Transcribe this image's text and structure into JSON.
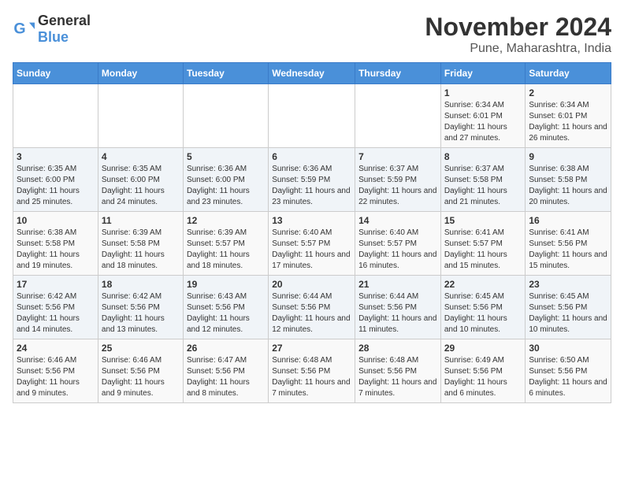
{
  "header": {
    "logo_general": "General",
    "logo_blue": "Blue",
    "month_title": "November 2024",
    "location": "Pune, Maharashtra, India"
  },
  "weekdays": [
    "Sunday",
    "Monday",
    "Tuesday",
    "Wednesday",
    "Thursday",
    "Friday",
    "Saturday"
  ],
  "rows": [
    [
      {
        "day": "",
        "info": ""
      },
      {
        "day": "",
        "info": ""
      },
      {
        "day": "",
        "info": ""
      },
      {
        "day": "",
        "info": ""
      },
      {
        "day": "",
        "info": ""
      },
      {
        "day": "1",
        "info": "Sunrise: 6:34 AM\nSunset: 6:01 PM\nDaylight: 11 hours and 27 minutes."
      },
      {
        "day": "2",
        "info": "Sunrise: 6:34 AM\nSunset: 6:01 PM\nDaylight: 11 hours and 26 minutes."
      }
    ],
    [
      {
        "day": "3",
        "info": "Sunrise: 6:35 AM\nSunset: 6:00 PM\nDaylight: 11 hours and 25 minutes."
      },
      {
        "day": "4",
        "info": "Sunrise: 6:35 AM\nSunset: 6:00 PM\nDaylight: 11 hours and 24 minutes."
      },
      {
        "day": "5",
        "info": "Sunrise: 6:36 AM\nSunset: 6:00 PM\nDaylight: 11 hours and 23 minutes."
      },
      {
        "day": "6",
        "info": "Sunrise: 6:36 AM\nSunset: 5:59 PM\nDaylight: 11 hours and 23 minutes."
      },
      {
        "day": "7",
        "info": "Sunrise: 6:37 AM\nSunset: 5:59 PM\nDaylight: 11 hours and 22 minutes."
      },
      {
        "day": "8",
        "info": "Sunrise: 6:37 AM\nSunset: 5:58 PM\nDaylight: 11 hours and 21 minutes."
      },
      {
        "day": "9",
        "info": "Sunrise: 6:38 AM\nSunset: 5:58 PM\nDaylight: 11 hours and 20 minutes."
      }
    ],
    [
      {
        "day": "10",
        "info": "Sunrise: 6:38 AM\nSunset: 5:58 PM\nDaylight: 11 hours and 19 minutes."
      },
      {
        "day": "11",
        "info": "Sunrise: 6:39 AM\nSunset: 5:58 PM\nDaylight: 11 hours and 18 minutes."
      },
      {
        "day": "12",
        "info": "Sunrise: 6:39 AM\nSunset: 5:57 PM\nDaylight: 11 hours and 18 minutes."
      },
      {
        "day": "13",
        "info": "Sunrise: 6:40 AM\nSunset: 5:57 PM\nDaylight: 11 hours and 17 minutes."
      },
      {
        "day": "14",
        "info": "Sunrise: 6:40 AM\nSunset: 5:57 PM\nDaylight: 11 hours and 16 minutes."
      },
      {
        "day": "15",
        "info": "Sunrise: 6:41 AM\nSunset: 5:57 PM\nDaylight: 11 hours and 15 minutes."
      },
      {
        "day": "16",
        "info": "Sunrise: 6:41 AM\nSunset: 5:56 PM\nDaylight: 11 hours and 15 minutes."
      }
    ],
    [
      {
        "day": "17",
        "info": "Sunrise: 6:42 AM\nSunset: 5:56 PM\nDaylight: 11 hours and 14 minutes."
      },
      {
        "day": "18",
        "info": "Sunrise: 6:42 AM\nSunset: 5:56 PM\nDaylight: 11 hours and 13 minutes."
      },
      {
        "day": "19",
        "info": "Sunrise: 6:43 AM\nSunset: 5:56 PM\nDaylight: 11 hours and 12 minutes."
      },
      {
        "day": "20",
        "info": "Sunrise: 6:44 AM\nSunset: 5:56 PM\nDaylight: 11 hours and 12 minutes."
      },
      {
        "day": "21",
        "info": "Sunrise: 6:44 AM\nSunset: 5:56 PM\nDaylight: 11 hours and 11 minutes."
      },
      {
        "day": "22",
        "info": "Sunrise: 6:45 AM\nSunset: 5:56 PM\nDaylight: 11 hours and 10 minutes."
      },
      {
        "day": "23",
        "info": "Sunrise: 6:45 AM\nSunset: 5:56 PM\nDaylight: 11 hours and 10 minutes."
      }
    ],
    [
      {
        "day": "24",
        "info": "Sunrise: 6:46 AM\nSunset: 5:56 PM\nDaylight: 11 hours and 9 minutes."
      },
      {
        "day": "25",
        "info": "Sunrise: 6:46 AM\nSunset: 5:56 PM\nDaylight: 11 hours and 9 minutes."
      },
      {
        "day": "26",
        "info": "Sunrise: 6:47 AM\nSunset: 5:56 PM\nDaylight: 11 hours and 8 minutes."
      },
      {
        "day": "27",
        "info": "Sunrise: 6:48 AM\nSunset: 5:56 PM\nDaylight: 11 hours and 7 minutes."
      },
      {
        "day": "28",
        "info": "Sunrise: 6:48 AM\nSunset: 5:56 PM\nDaylight: 11 hours and 7 minutes."
      },
      {
        "day": "29",
        "info": "Sunrise: 6:49 AM\nSunset: 5:56 PM\nDaylight: 11 hours and 6 minutes."
      },
      {
        "day": "30",
        "info": "Sunrise: 6:50 AM\nSunset: 5:56 PM\nDaylight: 11 hours and 6 minutes."
      }
    ]
  ]
}
